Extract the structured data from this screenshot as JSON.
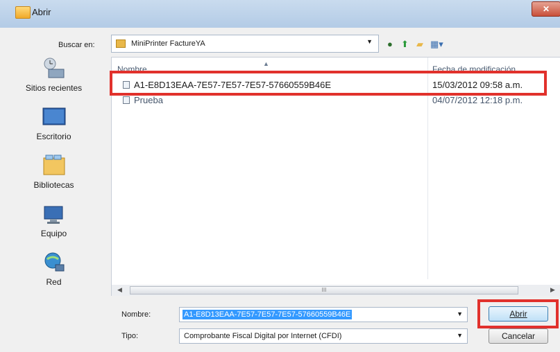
{
  "window": {
    "title": "Abrir",
    "close_label": "✕"
  },
  "lookin": {
    "label": "Buscar en:",
    "value": "MiniPrinter FactureYA",
    "toolbar_icons": [
      "back-icon",
      "up-folder-icon",
      "new-folder-icon",
      "view-menu-icon"
    ]
  },
  "places": [
    {
      "label": "Sitios recientes",
      "icon": "recent-places-icon"
    },
    {
      "label": "Escritorio",
      "icon": "desktop-icon"
    },
    {
      "label": "Bibliotecas",
      "icon": "libraries-icon"
    },
    {
      "label": "Equipo",
      "icon": "computer-icon"
    },
    {
      "label": "Red",
      "icon": "network-icon"
    }
  ],
  "filelist": {
    "columns": [
      "Nombre",
      "Fecha de modificación"
    ],
    "rows": [
      {
        "name": "A1-E8D13EAA-7E57-7E57-7E57-57660559B46E",
        "date": "15/03/2012 09:58 a.m."
      },
      {
        "name": "Prueba",
        "date": "04/07/2012 12:18 p.m."
      }
    ],
    "scroll_mark": "III"
  },
  "form": {
    "name_label": "Nombre:",
    "name_value": "A1-E8D13EAA-7E57-7E57-7E57-57660559B46E",
    "type_label": "Tipo:",
    "type_value": "Comprobante Fiscal Digital por Internet (CFDI)"
  },
  "buttons": {
    "open": "Abrir",
    "cancel": "Cancelar"
  },
  "colors": {
    "highlight": "#e1312c",
    "selection": "#3399ff"
  }
}
